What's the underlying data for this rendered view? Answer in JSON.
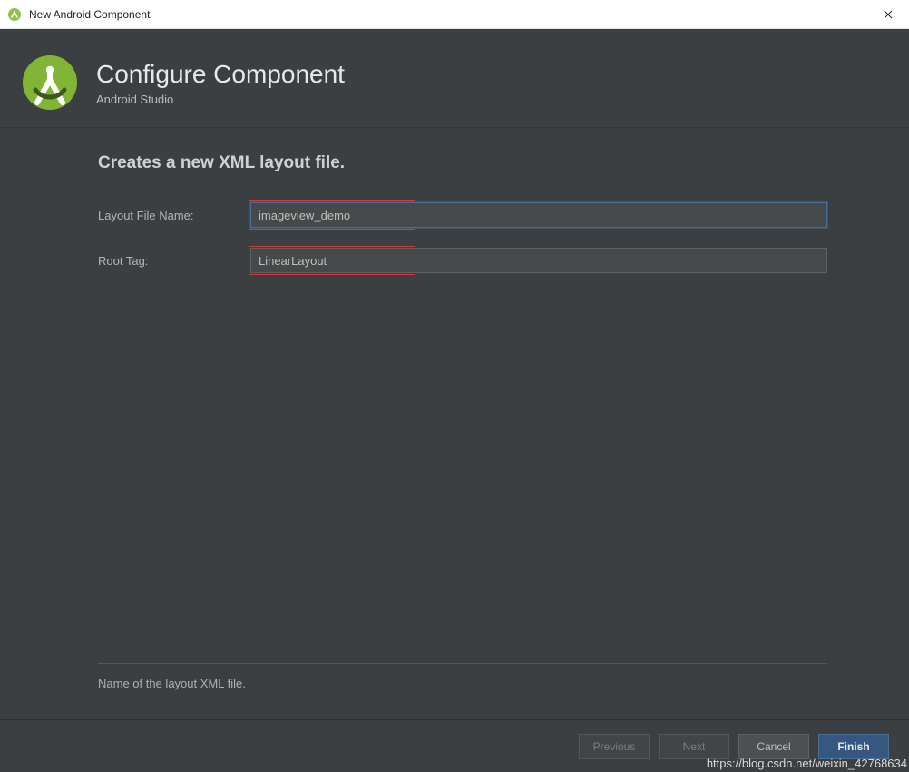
{
  "window": {
    "title": "New Android Component"
  },
  "header": {
    "title": "Configure Component",
    "subtitle": "Android Studio"
  },
  "section": {
    "title": "Creates a new XML layout file."
  },
  "form": {
    "layout_file_name": {
      "label": "Layout File Name:",
      "value": "imageview_demo"
    },
    "root_tag": {
      "label": "Root Tag:",
      "value": "LinearLayout"
    }
  },
  "hint": {
    "text": "Name of the layout XML file."
  },
  "footer": {
    "previous": "Previous",
    "next": "Next",
    "cancel": "Cancel",
    "finish": "Finish"
  },
  "watermark": "https://blog.csdn.net/weixin_42768634"
}
